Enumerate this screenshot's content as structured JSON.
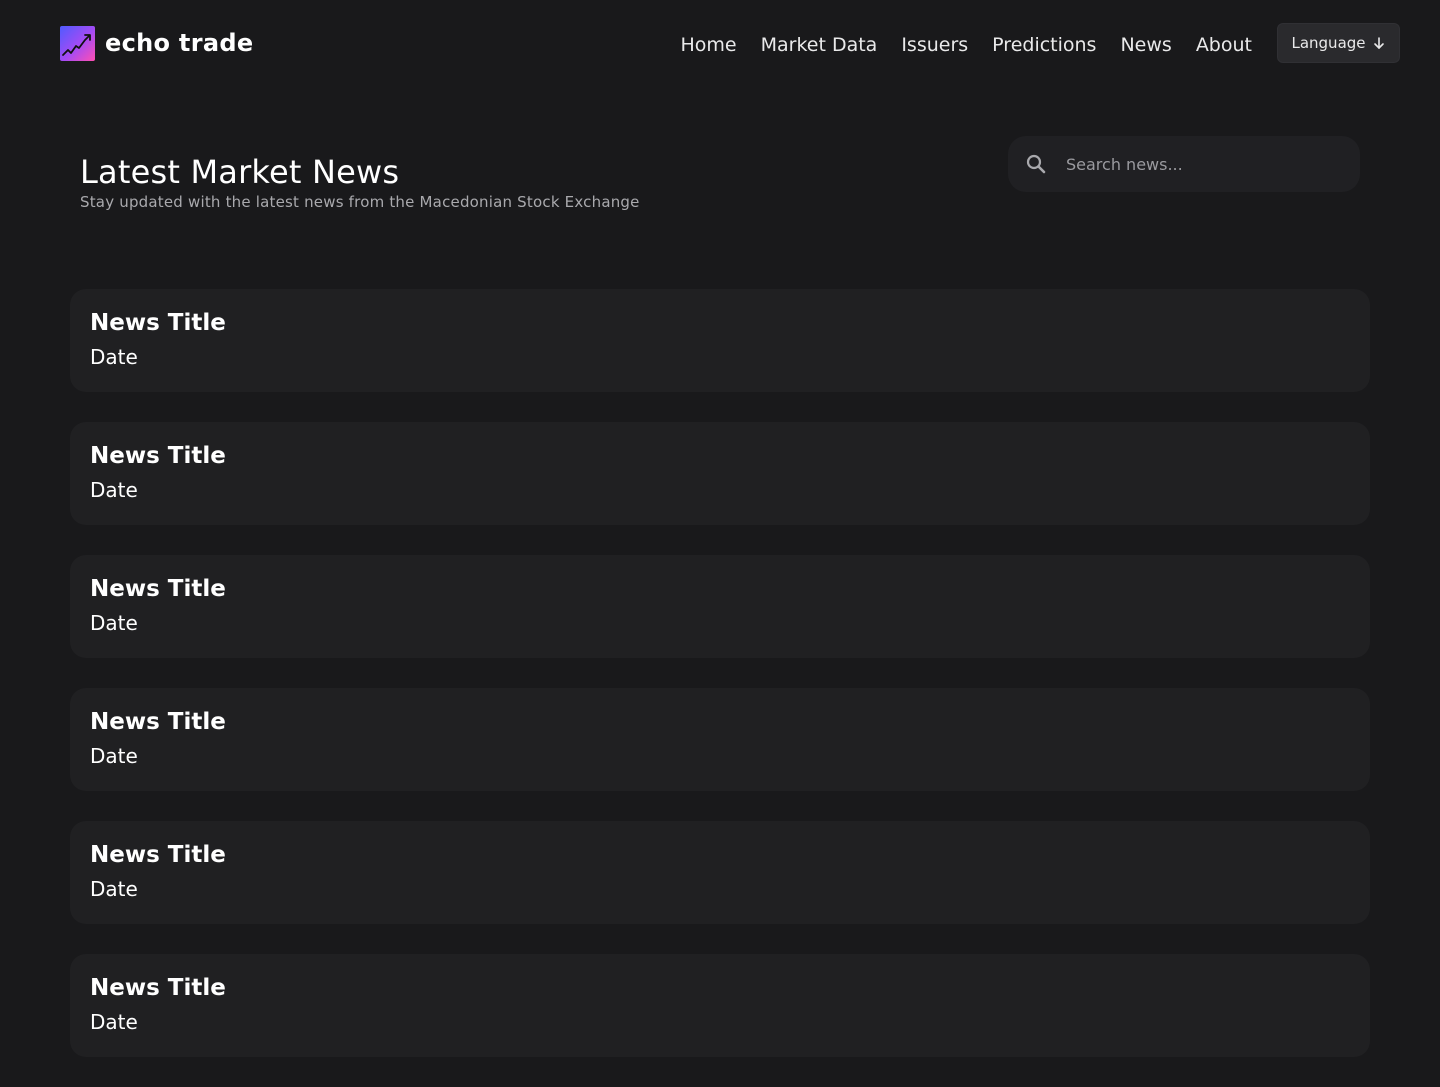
{
  "brand": {
    "name": "echo trade",
    "accent_gradient": [
      "#4f5bff",
      "#a64bf4",
      "#ff4fb2"
    ]
  },
  "nav": {
    "items": [
      "Home",
      "Market Data",
      "Issuers",
      "Predictions",
      "News",
      "About"
    ],
    "language_label": "Language",
    "language_icon": "arrow-down-icon"
  },
  "page": {
    "title": "Latest Market News",
    "subtitle": "Stay updated with the latest news from the Macedonian Stock Exchange"
  },
  "search": {
    "placeholder": "Search news...",
    "value": "",
    "icon": "search-icon"
  },
  "news": [
    {
      "title": "News Title",
      "date": "Date"
    },
    {
      "title": "News Title",
      "date": "Date"
    },
    {
      "title": "News Title",
      "date": "Date"
    },
    {
      "title": "News Title",
      "date": "Date"
    },
    {
      "title": "News Title",
      "date": "Date"
    },
    {
      "title": "News Title",
      "date": "Date"
    }
  ],
  "colors": {
    "background": "#19191b",
    "card": "#202022",
    "text": "#ffffff",
    "muted_text": "#a9a9ad"
  }
}
